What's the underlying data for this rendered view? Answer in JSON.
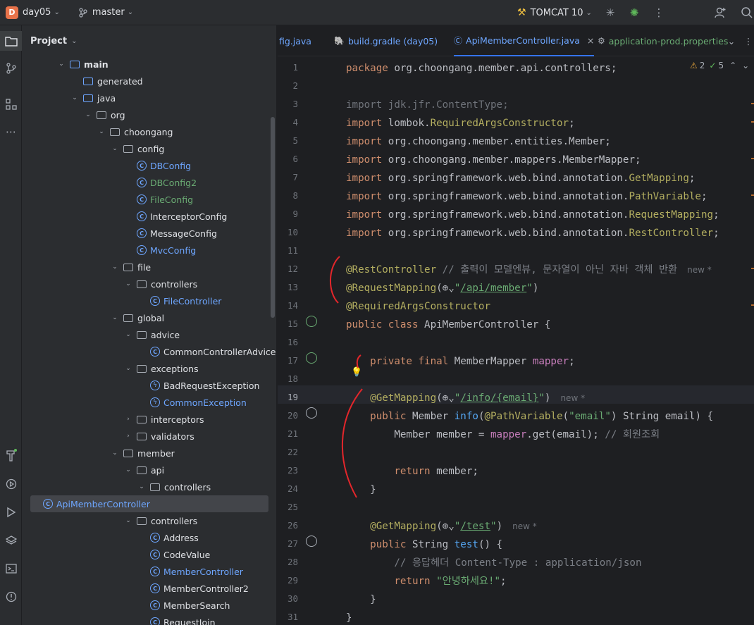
{
  "topbar": {
    "project_badge": "D",
    "project_name": "day05",
    "branch": "master",
    "run_config": "TOMCAT 10"
  },
  "project_panel": {
    "title": "Project",
    "tree": [
      {
        "label": "main",
        "depth": 0,
        "type": "folder-src",
        "expanded": true,
        "bold": true
      },
      {
        "label": "generated",
        "depth": 1,
        "type": "folder-src",
        "expanded": null
      },
      {
        "label": "java",
        "depth": 1,
        "type": "folder-src",
        "expanded": true
      },
      {
        "label": "org",
        "depth": 2,
        "type": "package",
        "expanded": true
      },
      {
        "label": "choongang",
        "depth": 3,
        "type": "package",
        "expanded": true
      },
      {
        "label": "config",
        "depth": 4,
        "type": "package",
        "expanded": true
      },
      {
        "label": "DBConfig",
        "depth": 5,
        "type": "class",
        "color": "blue"
      },
      {
        "label": "DBConfig2",
        "depth": 5,
        "type": "class",
        "color": "green"
      },
      {
        "label": "FileConfig",
        "depth": 5,
        "type": "class",
        "color": "green"
      },
      {
        "label": "InterceptorConfig",
        "depth": 5,
        "type": "class",
        "color": "default"
      },
      {
        "label": "MessageConfig",
        "depth": 5,
        "type": "class",
        "color": "default"
      },
      {
        "label": "MvcConfig",
        "depth": 5,
        "type": "class",
        "color": "blue"
      },
      {
        "label": "file",
        "depth": 4,
        "type": "package",
        "expanded": true
      },
      {
        "label": "controllers",
        "depth": 5,
        "type": "package",
        "expanded": true
      },
      {
        "label": "FileController",
        "depth": 6,
        "type": "class",
        "color": "blue"
      },
      {
        "label": "global",
        "depth": 4,
        "type": "package",
        "expanded": true
      },
      {
        "label": "advice",
        "depth": 5,
        "type": "package",
        "expanded": true
      },
      {
        "label": "CommonControllerAdvice",
        "depth": 6,
        "type": "class",
        "color": "default"
      },
      {
        "label": "exceptions",
        "depth": 5,
        "type": "package",
        "expanded": true
      },
      {
        "label": "BadRequestException",
        "depth": 6,
        "type": "exception",
        "color": "default"
      },
      {
        "label": "CommonException",
        "depth": 6,
        "type": "exception",
        "color": "blue"
      },
      {
        "label": "interceptors",
        "depth": 5,
        "type": "package",
        "expanded": false
      },
      {
        "label": "validators",
        "depth": 5,
        "type": "package",
        "expanded": false
      },
      {
        "label": "member",
        "depth": 4,
        "type": "package",
        "expanded": true
      },
      {
        "label": "api",
        "depth": 5,
        "type": "package",
        "expanded": true
      },
      {
        "label": "controllers",
        "depth": 6,
        "type": "package",
        "expanded": true
      },
      {
        "label": "ApiMemberController",
        "depth": 7,
        "type": "class",
        "color": "blue",
        "selected": true
      },
      {
        "label": "controllers",
        "depth": 5,
        "type": "package",
        "expanded": true
      },
      {
        "label": "Address",
        "depth": 6,
        "type": "class",
        "color": "default"
      },
      {
        "label": "CodeValue",
        "depth": 6,
        "type": "class",
        "color": "default"
      },
      {
        "label": "MemberController",
        "depth": 6,
        "type": "class",
        "color": "blue"
      },
      {
        "label": "MemberController2",
        "depth": 6,
        "type": "class",
        "color": "default"
      },
      {
        "label": "MemberSearch",
        "depth": 6,
        "type": "class",
        "color": "default"
      },
      {
        "label": "RequestJoin",
        "depth": 6,
        "type": "class",
        "color": "default"
      }
    ]
  },
  "editor": {
    "tabs": [
      {
        "label": "fig.java",
        "active": false
      },
      {
        "label": "build.gradle (day05)",
        "active": false
      },
      {
        "label": "ApiMemberController.java",
        "active": true
      },
      {
        "label": "application-prod.properties",
        "active": false
      }
    ],
    "inspections": {
      "warnings": "2",
      "ok": "5"
    },
    "current_line": "19",
    "lines": [
      {
        "n": "1",
        "tokens": [
          [
            "kw",
            "package "
          ],
          [
            "",
            "org.choongang.member.api.controllers;"
          ]
        ]
      },
      {
        "n": "2",
        "tokens": []
      },
      {
        "n": "3",
        "tokens": [
          [
            "gray",
            "import jdk.jfr.ContentType;"
          ]
        ]
      },
      {
        "n": "4",
        "tokens": [
          [
            "kw",
            "import "
          ],
          [
            "",
            "lombok."
          ],
          [
            "ann",
            "RequiredArgsConstructor"
          ],
          [
            "",
            ";"
          ]
        ]
      },
      {
        "n": "5",
        "tokens": [
          [
            "kw",
            "import "
          ],
          [
            "",
            "org.choongang.member.entities.Member;"
          ]
        ]
      },
      {
        "n": "6",
        "tokens": [
          [
            "kw",
            "import "
          ],
          [
            "",
            "org.choongang.member.mappers.MemberMapper;"
          ]
        ]
      },
      {
        "n": "7",
        "tokens": [
          [
            "kw",
            "import "
          ],
          [
            "",
            "org.springframework.web.bind.annotation."
          ],
          [
            "ann",
            "GetMapping"
          ],
          [
            "",
            ";"
          ]
        ]
      },
      {
        "n": "8",
        "tokens": [
          [
            "kw",
            "import "
          ],
          [
            "",
            "org.springframework.web.bind.annotation."
          ],
          [
            "ann",
            "PathVariable"
          ],
          [
            "",
            ";"
          ]
        ]
      },
      {
        "n": "9",
        "tokens": [
          [
            "kw",
            "import "
          ],
          [
            "",
            "org.springframework.web.bind.annotation."
          ],
          [
            "ann",
            "RequestMapping"
          ],
          [
            "",
            ";"
          ]
        ]
      },
      {
        "n": "10",
        "tokens": [
          [
            "kw",
            "import "
          ],
          [
            "",
            "org.springframework.web.bind.annotation."
          ],
          [
            "ann",
            "RestController"
          ],
          [
            "",
            ";"
          ]
        ]
      },
      {
        "n": "11",
        "tokens": []
      },
      {
        "n": "12",
        "tokens": [
          [
            "ann",
            "@RestController"
          ],
          [
            "cmt",
            " // 출력이 모델엔뷰, 문자열이 아닌 자바 객체 반환"
          ]
        ],
        "hint": "new *"
      },
      {
        "n": "13",
        "tokens": [
          [
            "ann",
            "@RequestMapping"
          ],
          [
            "",
            "(⊕⌄"
          ],
          [
            "str",
            "\""
          ],
          [
            "str-u",
            "/api/member"
          ],
          [
            "str",
            "\""
          ],
          [
            "",
            ")"
          ]
        ]
      },
      {
        "n": "14",
        "tokens": [
          [
            "ann",
            "@RequiredArgsConstructor"
          ]
        ]
      },
      {
        "n": "15",
        "tokens": [
          [
            "kw",
            "public class "
          ],
          [
            "",
            "ApiMemberController {"
          ]
        ]
      },
      {
        "n": "16",
        "tokens": []
      },
      {
        "n": "17",
        "tokens": [
          [
            "",
            "    "
          ],
          [
            "kw",
            "private final "
          ],
          [
            "",
            "MemberMapper "
          ],
          [
            "fld",
            "mapper"
          ],
          [
            "",
            ";"
          ]
        ]
      },
      {
        "n": "18",
        "tokens": []
      },
      {
        "n": "19",
        "tokens": [
          [
            "",
            "    "
          ],
          [
            "ann",
            "@GetMapping"
          ],
          [
            "",
            "(⊕⌄"
          ],
          [
            "str",
            "\""
          ],
          [
            "str-u",
            "/info/{email}"
          ],
          [
            "str",
            "\""
          ],
          [
            "",
            ")"
          ]
        ],
        "hint": "new *"
      },
      {
        "n": "20",
        "tokens": [
          [
            "",
            "    "
          ],
          [
            "kw",
            "public "
          ],
          [
            "",
            "Member "
          ],
          [
            "fn",
            "info"
          ],
          [
            "",
            "("
          ],
          [
            "ann",
            "@PathVariable"
          ],
          [
            "",
            "("
          ],
          [
            "str",
            "\"email\""
          ],
          [
            "",
            ") String email) {"
          ]
        ]
      },
      {
        "n": "21",
        "tokens": [
          [
            "",
            "        Member member = "
          ],
          [
            "fld",
            "mapper"
          ],
          [
            "",
            ".get(email); "
          ],
          [
            "cmt",
            "// 회원조회"
          ]
        ]
      },
      {
        "n": "22",
        "tokens": []
      },
      {
        "n": "23",
        "tokens": [
          [
            "",
            "        "
          ],
          [
            "kw",
            "return "
          ],
          [
            "",
            "member;"
          ]
        ]
      },
      {
        "n": "24",
        "tokens": [
          [
            "",
            "    }"
          ]
        ]
      },
      {
        "n": "25",
        "tokens": []
      },
      {
        "n": "26",
        "tokens": [
          [
            "",
            "    "
          ],
          [
            "ann",
            "@GetMapping"
          ],
          [
            "",
            "(⊕⌄"
          ],
          [
            "str",
            "\""
          ],
          [
            "str-u",
            "/test"
          ],
          [
            "str",
            "\""
          ],
          [
            "",
            ")"
          ]
        ],
        "hint": "new *"
      },
      {
        "n": "27",
        "tokens": [
          [
            "",
            "    "
          ],
          [
            "kw",
            "public "
          ],
          [
            "",
            "String "
          ],
          [
            "fn",
            "test"
          ],
          [
            "",
            "() {"
          ]
        ]
      },
      {
        "n": "28",
        "tokens": [
          [
            "",
            "        "
          ],
          [
            "cmt",
            "// 응답헤더 Content-Type : application/json"
          ]
        ]
      },
      {
        "n": "29",
        "tokens": [
          [
            "",
            "        "
          ],
          [
            "kw",
            "return "
          ],
          [
            "str",
            "\"안녕하세요!\""
          ],
          [
            "",
            ";"
          ]
        ]
      },
      {
        "n": "30",
        "tokens": [
          [
            "",
            "    }"
          ]
        ]
      },
      {
        "n": "31",
        "tokens": [
          [
            "",
            "}"
          ]
        ]
      }
    ]
  },
  "colors": {
    "background": "#1e1f22",
    "panel": "#2b2d30",
    "keyword": "#cf8e6d",
    "annotation": "#b3ae60",
    "string": "#6aab73",
    "accent": "#3574f0"
  }
}
